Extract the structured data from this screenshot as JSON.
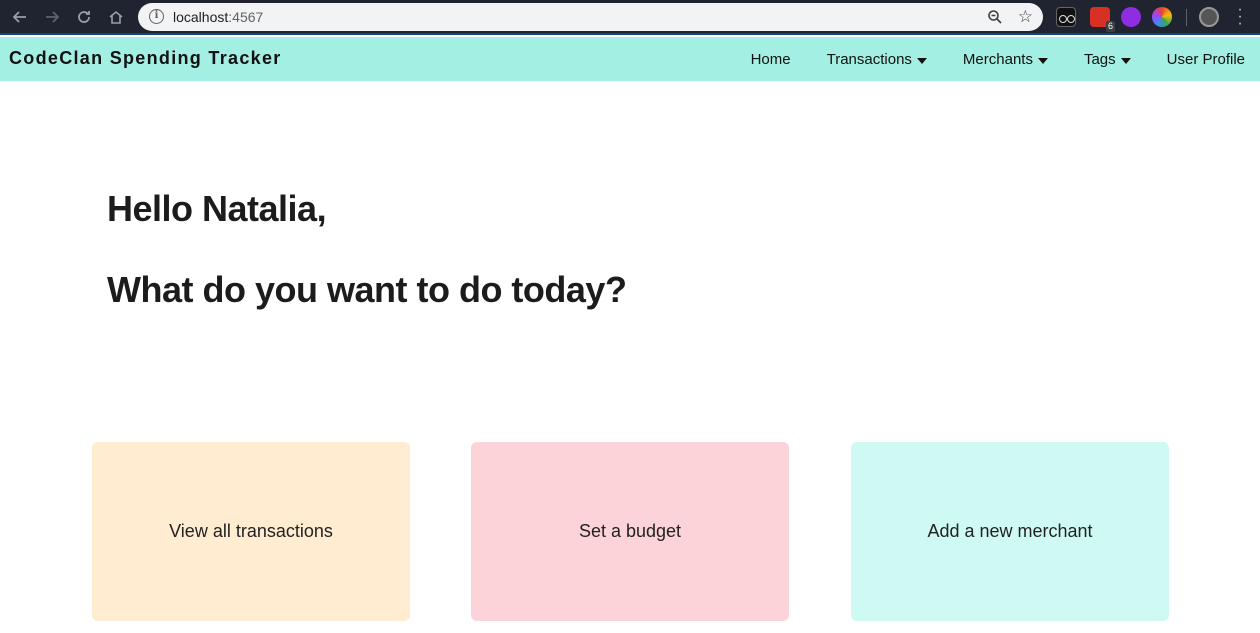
{
  "browser": {
    "url_host": "localhost",
    "url_port": ":4567",
    "extension_badge": "6"
  },
  "header": {
    "title": "CodeClan Spending Tracker",
    "nav": {
      "home": "Home",
      "transactions": "Transactions",
      "merchants": "Merchants",
      "tags": "Tags",
      "user_profile": "User Profile"
    }
  },
  "main": {
    "greeting": "Hello Natalia,",
    "question": "What do you want to do today?"
  },
  "cards": {
    "view_transactions": "View all transactions",
    "set_budget": "Set a budget",
    "add_merchant": "Add a new merchant"
  },
  "colors": {
    "header_bg": "#a3efe3",
    "card_transactions": "#ffecd1",
    "card_budget": "#fcd3d8",
    "card_merchant": "#cffaf3"
  }
}
